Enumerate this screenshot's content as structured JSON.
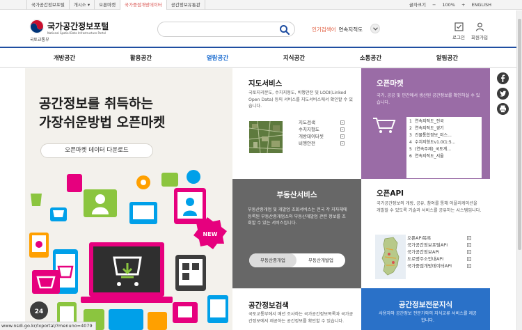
{
  "topbar": {
    "links": [
      {
        "label": "국가공간정보포털",
        "active": false
      },
      {
        "label": "개시소 ▾",
        "active": false
      },
      {
        "label": "오픈마켓",
        "active": false
      },
      {
        "label": "국가중점개방데이터",
        "active": true
      },
      {
        "label": "공간정보유통관",
        "active": false
      }
    ],
    "text_size": "글자크기",
    "zoom_out": "−",
    "zoom": "100%",
    "zoom_in": "+",
    "language": "ENGLISH"
  },
  "header": {
    "site_name": "국가공간정보포털",
    "site_sub": "National Spatial Data Infrastructure Portal",
    "ministry": "국토교통부",
    "search": {
      "placeholder": "",
      "value": ""
    },
    "popular_label": "인기검색어",
    "popular_value": "연속지적도",
    "login_label": "로그인",
    "join_label": "회원가입"
  },
  "gnb": {
    "items": [
      {
        "label": "개방공간",
        "active": false
      },
      {
        "label": "활용공간",
        "active": false
      },
      {
        "label": "열람공간",
        "active": true
      },
      {
        "label": "지식공간",
        "active": false
      },
      {
        "label": "소통공간",
        "active": false
      },
      {
        "label": "알림공간",
        "active": false
      }
    ]
  },
  "hero": {
    "line1": "공간정보를 취득하는",
    "line2": "가장쉬운방법 오픈마켓",
    "button": "오픈마켓 데이터 다운로드",
    "art_badge": "NEW"
  },
  "map_service": {
    "title": "지도서비스",
    "desc": "국토지리분도, 수치지형도, 비행안전 및 LODI(Linked Open Data) 등의 서비스를 지도서비스에서 확인할 수 있습니다.",
    "links": [
      "지도검색",
      "수치지형도",
      "개방데이터셋",
      "비행안전"
    ]
  },
  "open_market": {
    "title": "오픈마켓",
    "desc": "국가, 공공 및 민간에서 생산된 공간정보를 확인하실 수 있습니다.",
    "ranking": [
      {
        "no": "1",
        "label": "연속지적도_전국"
      },
      {
        "no": "2",
        "label": "연속지적도_경기"
      },
      {
        "no": "3",
        "label": "건물통합정보_미스..."
      },
      {
        "no": "4",
        "label": "수치지형도v1.0(1:5..."
      },
      {
        "no": "5",
        "label": "(연속주제)_국토계..."
      },
      {
        "no": "6",
        "label": "연속지적도_서울"
      }
    ]
  },
  "real_estate": {
    "title": "부동산서비스",
    "desc": "부동산중개업 및 개발업 조회서비스는 전국 각 지자체에 등록된 부동산중개업소와 부동산개발업 관련 정보를 조회할 수 있는 서비스입니다.",
    "tab1": "부동산중개업",
    "tab2": "부동산개발업"
  },
  "open_api": {
    "title": "오픈API",
    "desc": "국가공간정보의 개방, 공유, 참여를 통해 어플리케이션을 개발할 수 있도록 기술과 서비스를 공유하는 시스템입니다.",
    "links": [
      "오픈API목록",
      "국가공간정보포털API",
      "국가공간정보API",
      "도로명주소안내API",
      "국가중점개방데이터API"
    ]
  },
  "spatial_search": {
    "title": "공간정보검색",
    "desc": "국토교통부에서 매년 조사하는 국가공간정보목록과 국가공간정보에서 제공하는 공간정보를 확인할 수 있습니다."
  },
  "expert": {
    "title": "공간정보전문지식",
    "desc": "사용자와 공간정보 전문가와의 지식교류 서비스를 제공합니다."
  },
  "share": {
    "icons": [
      "facebook-icon",
      "twitter-icon",
      "print-icon"
    ]
  },
  "status_url": "www.nsdi.go.kr/lxportal/?menuno=4079",
  "colors": {
    "primary": "#1f4ea1",
    "active_link": "#1f6fd1",
    "popular": "#e0583a",
    "open_market": "#9a6ca6",
    "real_estate": "#676767",
    "expert": "#2a71c8",
    "hero_bg": "#f3f1ec"
  }
}
